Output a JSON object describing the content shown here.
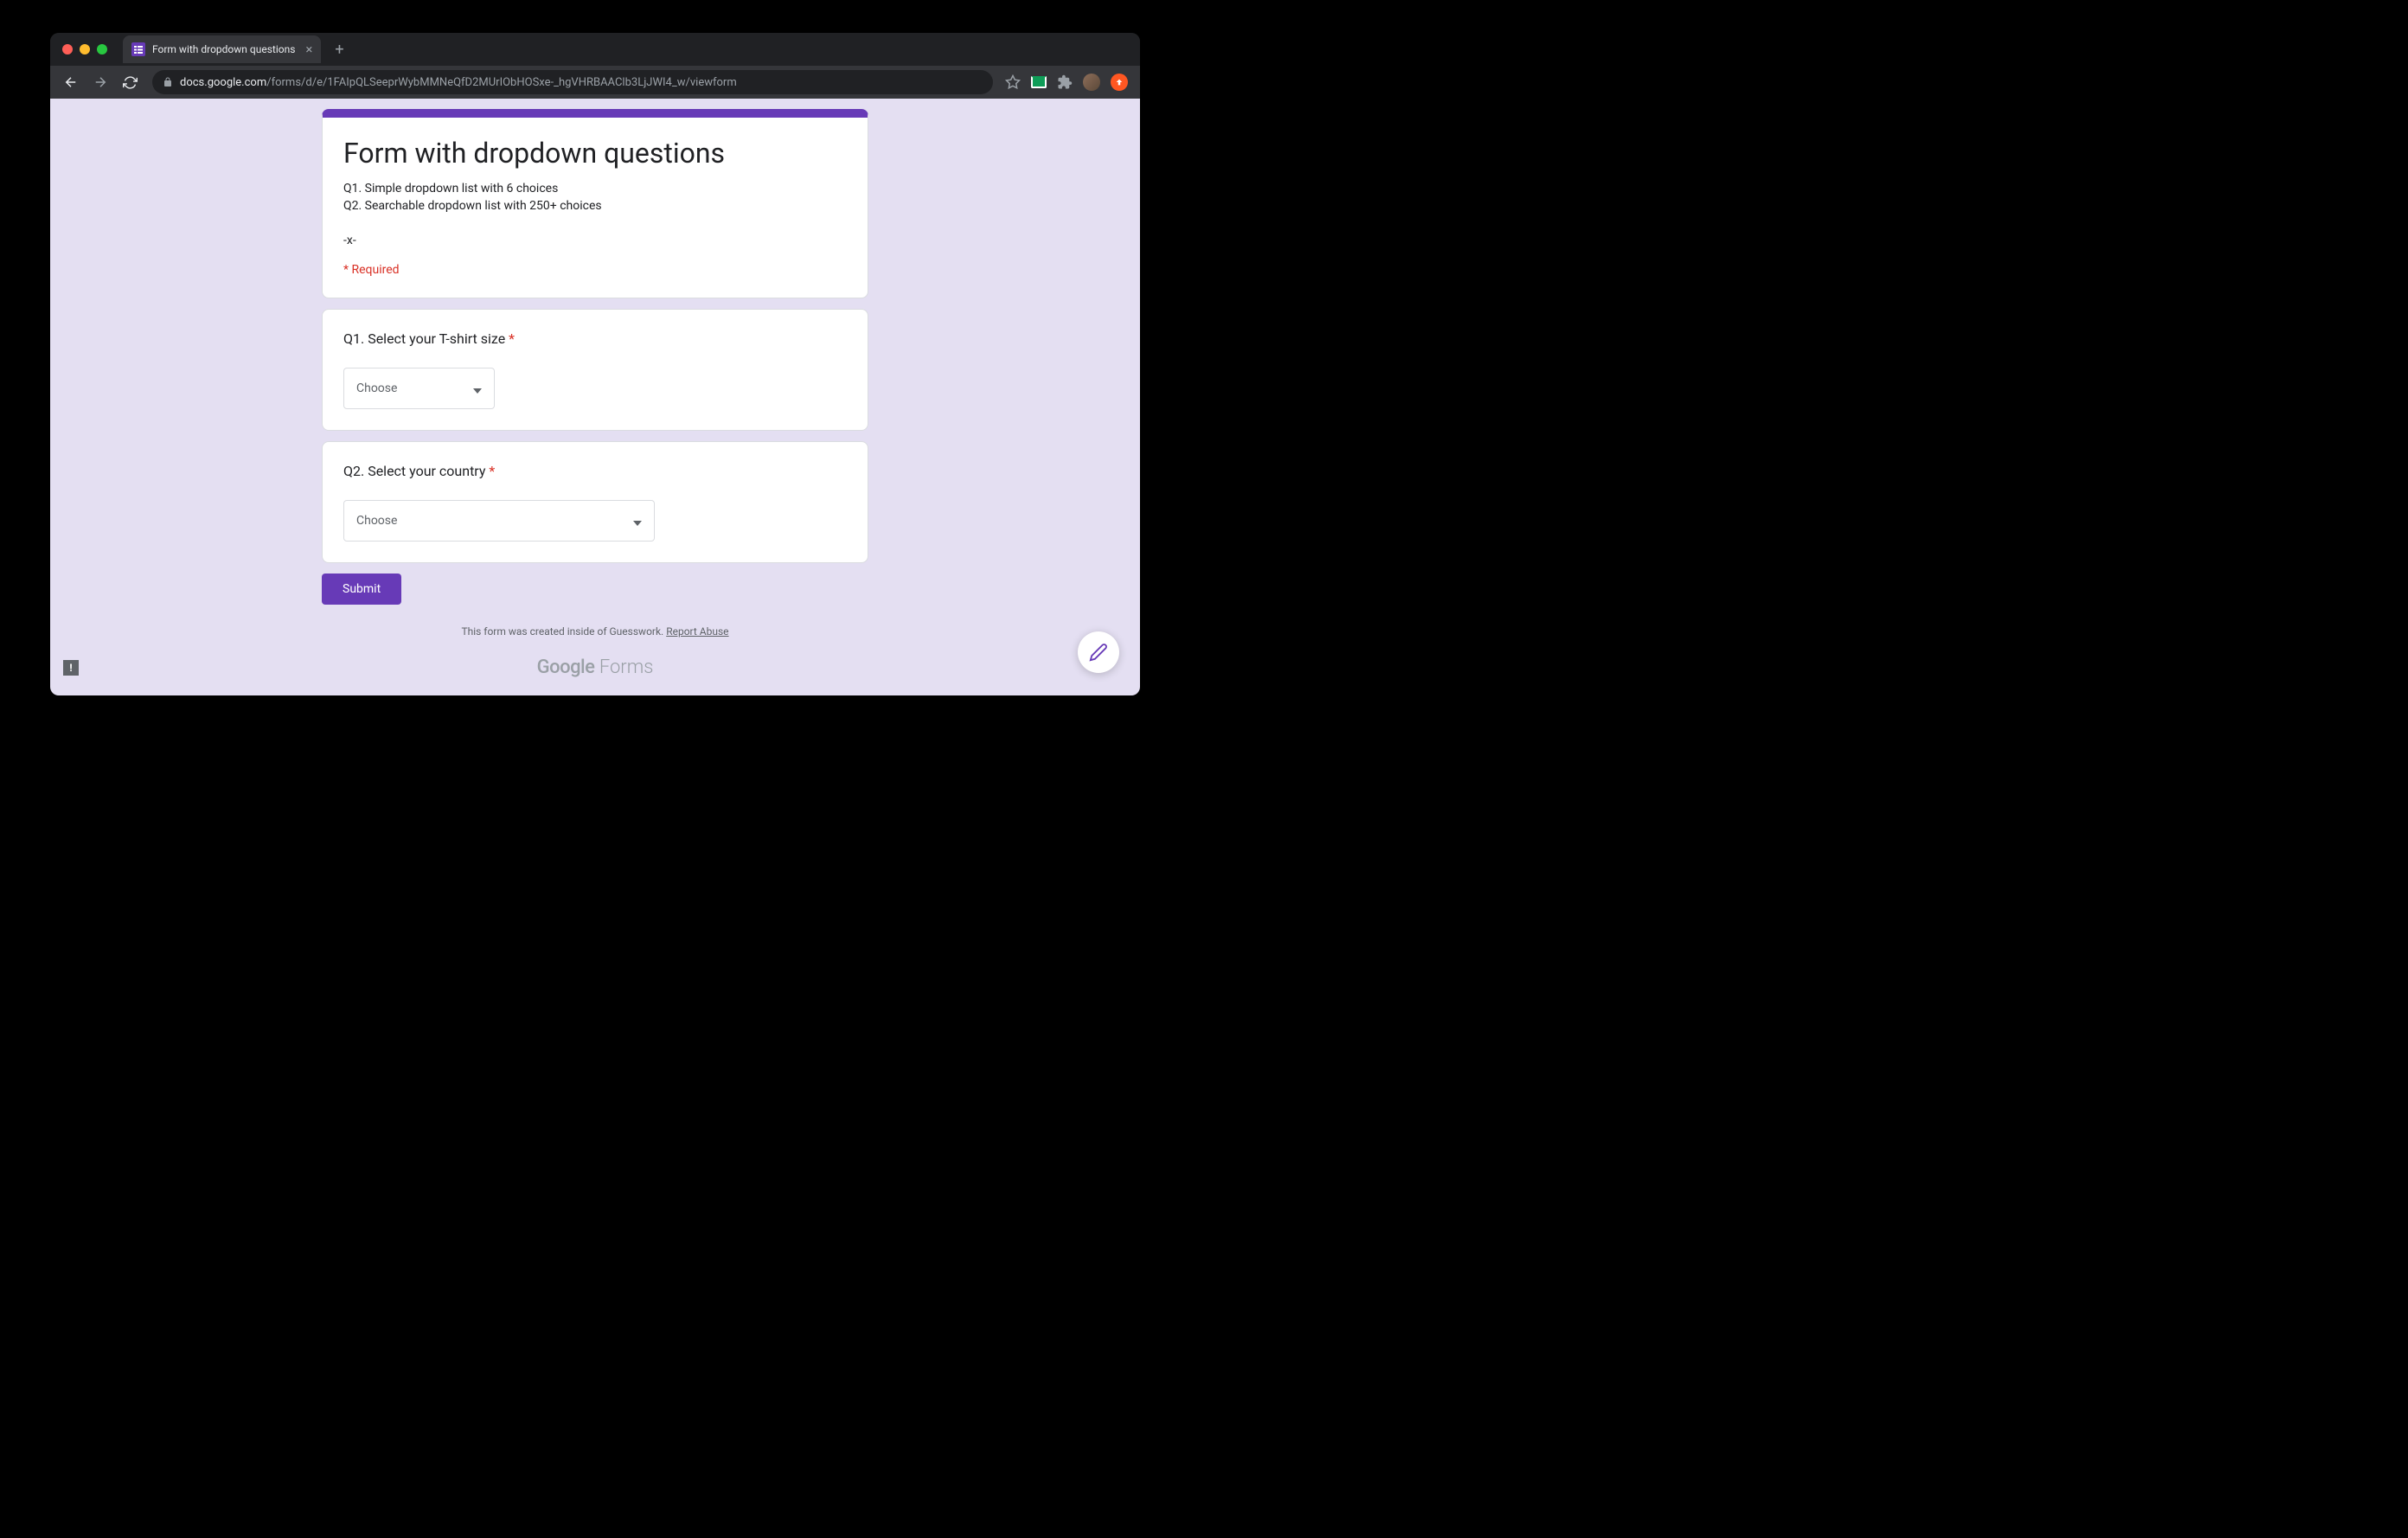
{
  "browser": {
    "tab_title": "Form with dropdown questions",
    "url_domain": "docs.google.com",
    "url_path": "/forms/d/e/1FAIpQLSeeprWybMMNeQfD2MUrIObHOSxe-_hgVHRBAAClb3LjJWI4_w/viewform"
  },
  "form": {
    "title": "Form with dropdown questions",
    "description": "Q1. Simple dropdown list with 6 choices\nQ2. Searchable dropdown list with 250+ choices\n\n-x-",
    "required_note": "* Required",
    "questions": [
      {
        "title": "Q1. Select your T-shirt size",
        "required": true,
        "placeholder": "Choose"
      },
      {
        "title": "Q2. Select your country",
        "required": true,
        "placeholder": "Choose"
      }
    ],
    "submit_label": "Submit",
    "footer_text": "This form was created inside of Guesswork. ",
    "report_abuse": "Report Abuse",
    "brand_google": "Google",
    "brand_forms": " Forms"
  },
  "star": "*"
}
